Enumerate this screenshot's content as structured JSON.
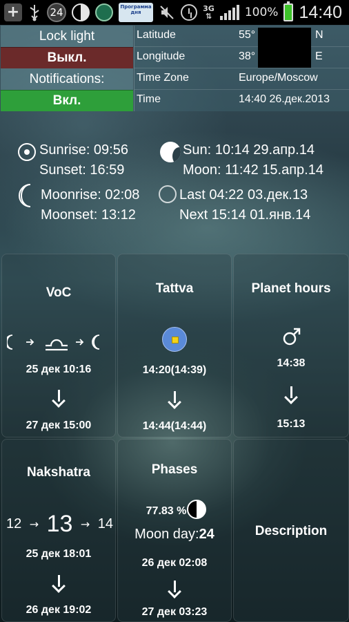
{
  "status_bar": {
    "notification_count": "24",
    "app_badge_text": "Программа дня",
    "network": "3G",
    "battery": "100%",
    "time": "14:40"
  },
  "lock_panel": {
    "lock_light_label": "Lock light",
    "lock_light_value": "Выкл.",
    "notifications_label": "Notifications:",
    "notifications_value": "Вкл."
  },
  "location": {
    "latitude_label": "Latitude",
    "latitude_value": "55°",
    "latitude_suffix": "N",
    "longitude_label": "Longitude",
    "longitude_value": "38°",
    "longitude_suffix": "E",
    "timezone_label": "Time Zone",
    "timezone_value": "Europe/Moscow",
    "time_label": "Time",
    "time_value": "14:40 26.дек.2013"
  },
  "astro": {
    "sunrise": "Sunrise: 09:56",
    "sunset": "Sunset: 16:59",
    "sun_sign": "Sun: 10:14 29.апр.14",
    "moon_sign": "Moon: 11:42 15.апр.14",
    "moonrise": "Moonrise: 02:08",
    "moonset": "Moonset: 13:12",
    "last": "Last 04:22 03.дек.13",
    "next": "Next 15:14 01.янв.14"
  },
  "tiles": {
    "voc": {
      "title": "VoC",
      "start": "25 дек 10:16",
      "end": "27 дек 15:00"
    },
    "tattva": {
      "title": "Tattva",
      "start": "14:20(14:39)",
      "end": "14:44(14:44)"
    },
    "planet_hours": {
      "title": "Planet hours",
      "start": "14:38",
      "end": "15:13"
    },
    "nakshatra": {
      "title": "Nakshatra",
      "prev": "12",
      "current": "13",
      "next": "14",
      "start": "25 дек 18:01",
      "end": "26 дек 19:02"
    },
    "phases": {
      "title": "Phases",
      "percent": "77.83 %",
      "moon_day_label": "Moon day:",
      "moon_day_value": "24",
      "start": "26 дек 02:08",
      "end": "27 дек 03:23"
    },
    "description": {
      "title": "Description"
    }
  },
  "colors": {
    "off_red": "#6b2a2a",
    "on_green": "#2e9f3a",
    "tattva_blue": "#5a8ad8",
    "tattva_yellow": "#f2d21a"
  }
}
